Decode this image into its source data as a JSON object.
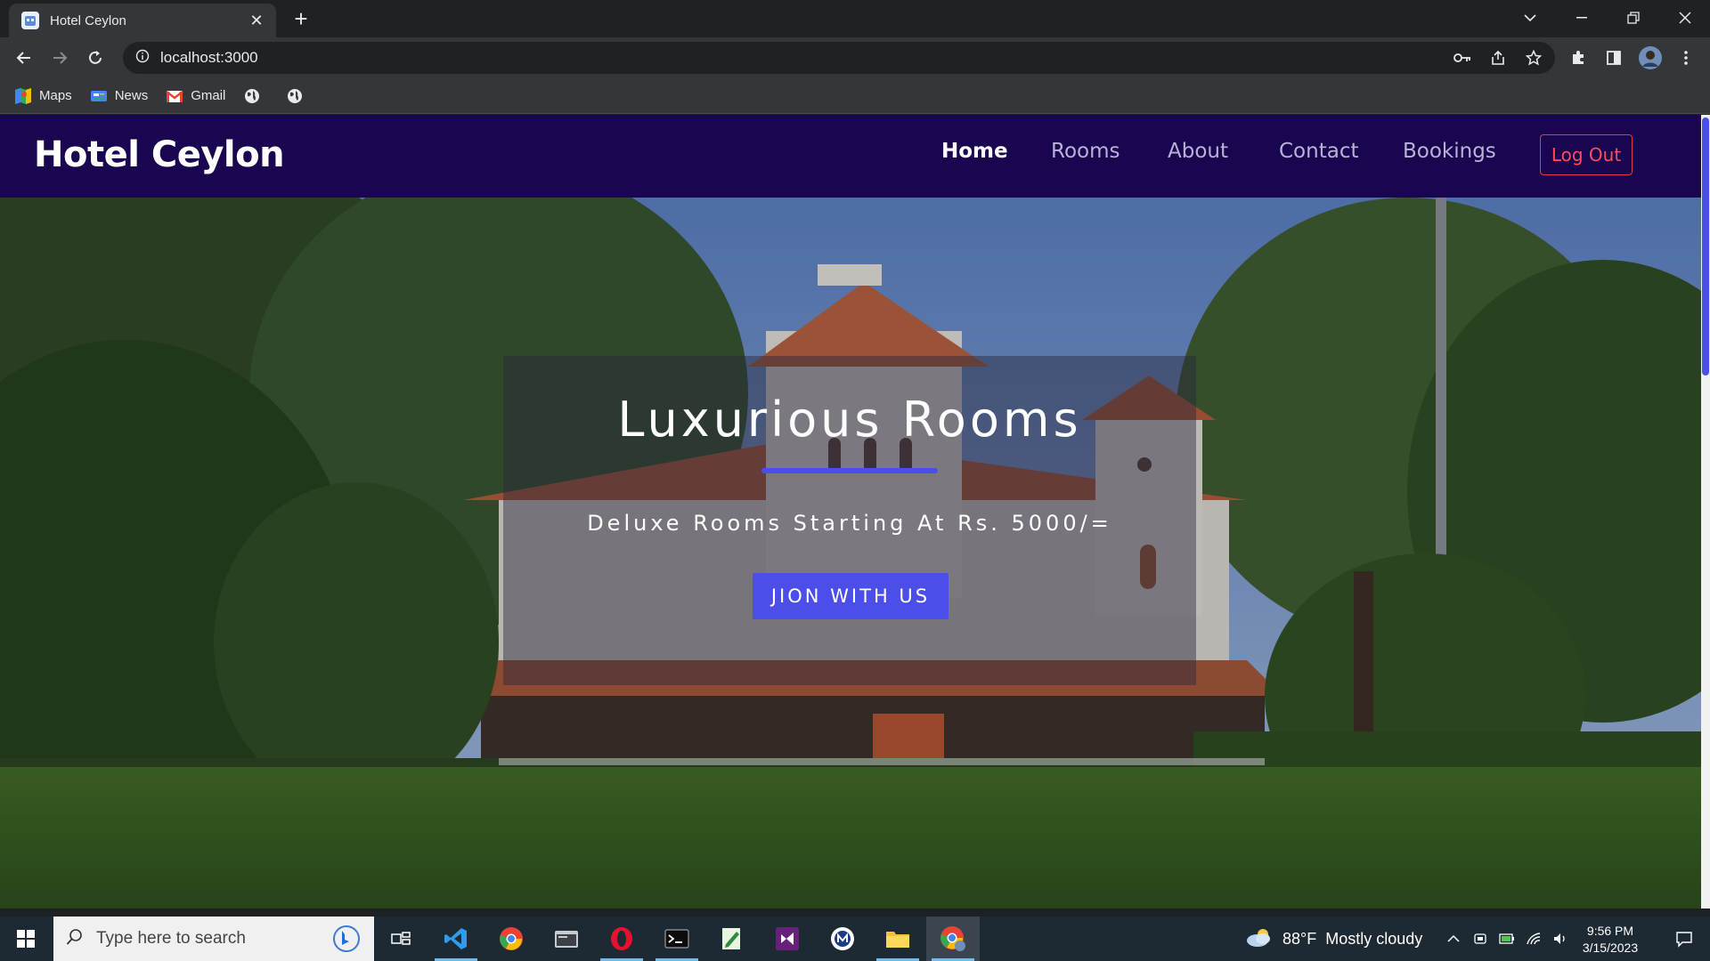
{
  "browser": {
    "tab_title": "Hotel Ceylon",
    "url": "localhost:3000",
    "bookmarks": [
      {
        "label": "Maps",
        "icon": "maps-icon"
      },
      {
        "label": "News",
        "icon": "news-icon"
      },
      {
        "label": "Gmail",
        "icon": "gmail-icon"
      },
      {
        "label": "",
        "icon": "globe-icon"
      },
      {
        "label": "",
        "icon": "globe-icon"
      }
    ]
  },
  "site": {
    "brand": "Hotel Ceylon",
    "nav": [
      {
        "label": "Home",
        "active": true
      },
      {
        "label": "Rooms",
        "active": false
      },
      {
        "label": "About",
        "active": false
      },
      {
        "label": "Contact",
        "active": false
      },
      {
        "label": "Bookings",
        "active": false
      }
    ],
    "logout_label": "Log Out",
    "accent": "#4b4ee8",
    "nav_bg": "#1a0550"
  },
  "hero": {
    "title": "Luxurious Rooms",
    "subtitle": "Deluxe Rooms Starting At Rs. 5000/=",
    "cta": "JION WITH US"
  },
  "taskbar": {
    "search_placeholder": "Type here to search",
    "weather": {
      "temp": "88°F",
      "condition": "Mostly cloudy"
    },
    "time": "9:56 PM",
    "date": "3/15/2023",
    "apps": [
      "task-view-icon",
      "vscode-icon",
      "chrome-icon",
      "file-manager-icon",
      "opera-icon",
      "terminal-icon",
      "editor-icon",
      "visual-studio-icon",
      "app-icon",
      "file-explorer-icon",
      "chrome-profile-icon"
    ]
  }
}
